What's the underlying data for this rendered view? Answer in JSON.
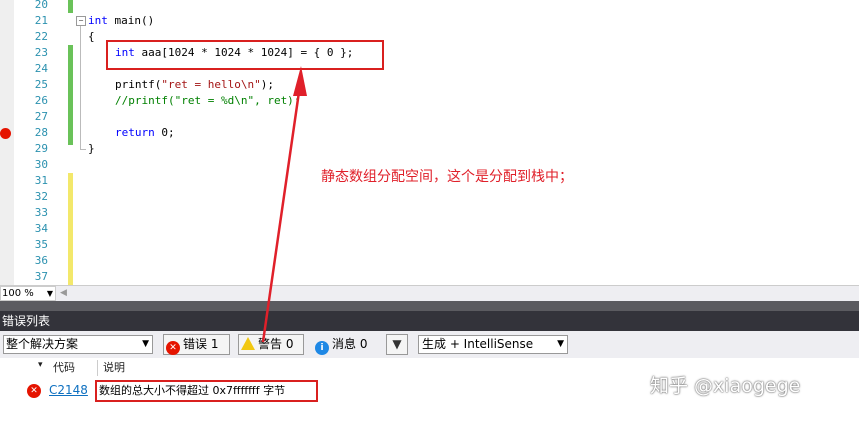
{
  "editor": {
    "line_numbers": [
      "20",
      "21",
      "22",
      "23",
      "24",
      "25",
      "26",
      "27",
      "28",
      "29",
      "30",
      "31",
      "32",
      "33",
      "34",
      "35",
      "36",
      "37"
    ],
    "code": {
      "line21_kw": "int",
      "line21_rest": " main()",
      "line22": "{",
      "line23_kw": "int",
      "line23_rest": " aaa[1024 * 1024 * 1024] = { 0 };",
      "line25_fn": "printf(",
      "line25_str": "\"ret = hello\\n\"",
      "line25_end": ");",
      "line26": "//printf(\"ret = %d\\n\", ret);",
      "line28_kw": "return",
      "line28_rest": " 0;",
      "line29": "}"
    },
    "annotation": "静态数组分配空间，这个是分配到栈中；",
    "zoom": "100 %"
  },
  "error_list": {
    "title": "错误列表",
    "scope": "整个解决方案",
    "errors_label": "错误 1",
    "warnings_label": "警告 0",
    "messages_label": "消息 0",
    "build_filter": "生成 + IntelliSense",
    "columns": {
      "code": "代码",
      "description": "说明"
    },
    "rows": [
      {
        "code": "C2148",
        "description": "数组的总大小不得超过 0x7fffffff 字节"
      }
    ]
  },
  "watermark": "知乎 @xiaogege",
  "colors": {
    "annotation": "#e0202a",
    "keyword": "#0000ff",
    "string": "#a31515",
    "comment": "#008000",
    "error": "#e51400",
    "link": "#0e70c0"
  }
}
